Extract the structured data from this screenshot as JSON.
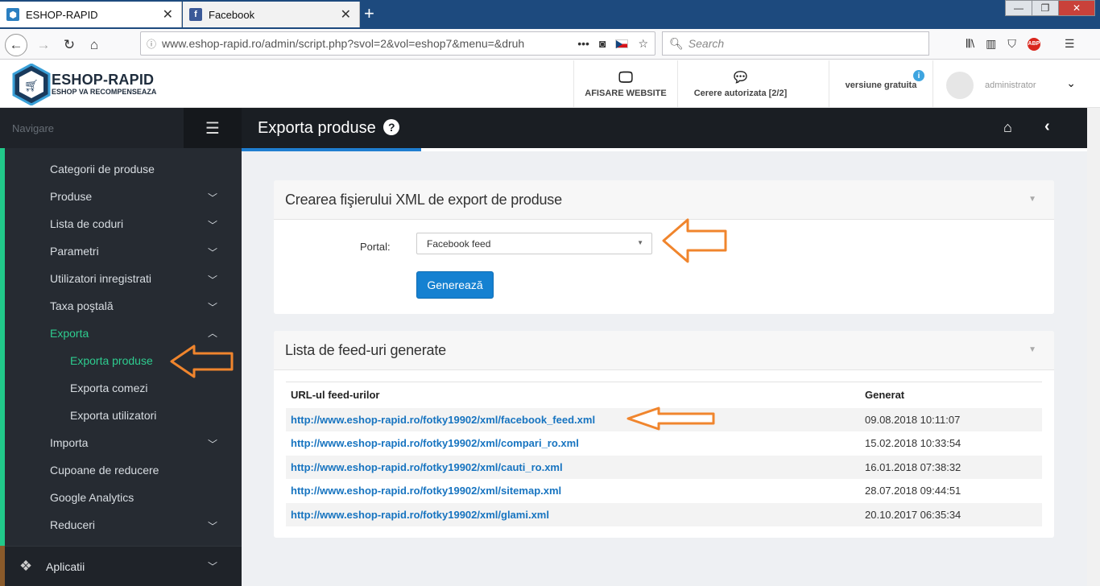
{
  "browser": {
    "tabs": [
      {
        "title": "ESHOP-RAPID",
        "active": true
      },
      {
        "title": "Facebook",
        "active": false
      }
    ],
    "url": "www.eshop-rapid.ro/admin/script.php?svol=2&vol=eshop7&menu=&druh",
    "search_placeholder": "Search"
  },
  "header": {
    "logo_title": "ESHOP-RAPID",
    "logo_subtitle": "ESHOP VA RECOMPENSEAZA",
    "website_label": "AFISARE WEBSITE",
    "requests_label": "Cerere autorizata [2/2]",
    "version_label": "versiune gratuita",
    "user_name": "administrator"
  },
  "sidebar": {
    "title": "Navigare",
    "items": [
      {
        "label": "Categorii de produse",
        "has_children": false
      },
      {
        "label": "Produse",
        "has_children": true
      },
      {
        "label": "Lista de coduri",
        "has_children": true
      },
      {
        "label": "Parametri",
        "has_children": true
      },
      {
        "label": "Utilizatori inregistrati",
        "has_children": true
      },
      {
        "label": "Taxa poştală",
        "has_children": true
      },
      {
        "label": "Exporta",
        "has_children": true,
        "expanded": true
      },
      {
        "label": "Exporta produse",
        "sub": true,
        "active": true
      },
      {
        "label": "Exporta comezi",
        "sub": true
      },
      {
        "label": "Exporta utilizatori",
        "sub": true
      },
      {
        "label": "Importa",
        "has_children": true
      },
      {
        "label": "Cupoane de reducere",
        "has_children": false
      },
      {
        "label": "Google Analytics",
        "has_children": false
      },
      {
        "label": "Reduceri",
        "has_children": true
      }
    ],
    "footer_label": "Aplicatii"
  },
  "page": {
    "title": "Exporta produse"
  },
  "create_panel": {
    "title": "Crearea fişierului XML de export de produse",
    "portal_label": "Portal:",
    "portal_value": "Facebook feed",
    "generate_label": "Generează"
  },
  "feeds_panel": {
    "title": "Lista de feed-uri generate",
    "col_url": "URL-ul feed-urilor",
    "col_date": "Generat",
    "rows": [
      {
        "url": "http://www.eshop-rapid.ro/fotky19902/xml/facebook_feed.xml",
        "date": "09.08.2018 10:11:07"
      },
      {
        "url": "http://www.eshop-rapid.ro/fotky19902/xml/compari_ro.xml",
        "date": "15.02.2018 10:33:54"
      },
      {
        "url": "http://www.eshop-rapid.ro/fotky19902/xml/cauti_ro.xml",
        "date": "16.01.2018 07:38:32"
      },
      {
        "url": "http://www.eshop-rapid.ro/fotky19902/xml/sitemap.xml",
        "date": "28.07.2018 09:44:51"
      },
      {
        "url": "http://www.eshop-rapid.ro/fotky19902/xml/glami.xml",
        "date": "20.10.2017 06:35:34"
      }
    ]
  },
  "colors": {
    "accent": "#21c98a",
    "primary_button": "#1581d1",
    "link": "#1774c0",
    "annotation_arrow": "#f0852d"
  }
}
